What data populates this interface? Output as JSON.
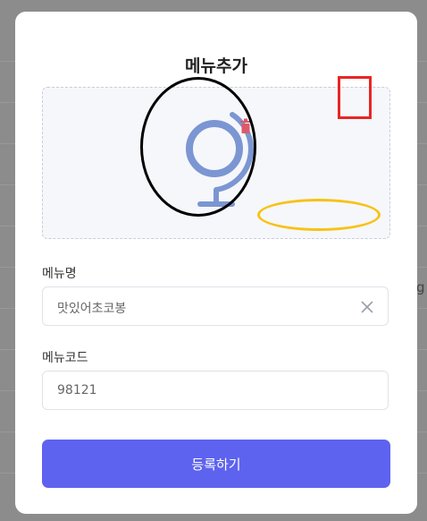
{
  "modal": {
    "title": "메뉴추가",
    "image_icon": "globe-icon",
    "delete_icon": "trash-icon",
    "menu_name": {
      "label": "메뉴명",
      "value": "맛있어초코봉",
      "clear_icon": "close-icon"
    },
    "menu_code": {
      "label": "메뉴코드",
      "value": "98121"
    },
    "submit_label": "등록하기"
  },
  "background": {
    "edge_text": "g"
  },
  "colors": {
    "accent": "#5e63ef",
    "globe": "#7b96d2",
    "trash": "#d95b6a",
    "annotation_black": "#000000",
    "annotation_red": "#e82525",
    "annotation_yellow": "#f7c215"
  }
}
